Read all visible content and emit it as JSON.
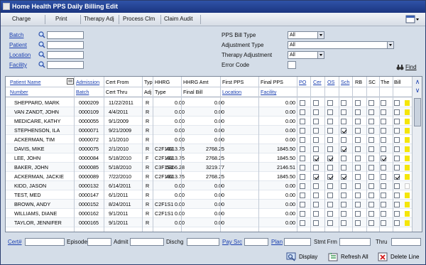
{
  "window": {
    "title": "Home Health PPS Daily Billing Edit"
  },
  "menu": {
    "items": [
      "Charge",
      "Print",
      "Therapy Adj",
      "Process Clm",
      "Claim Audit"
    ]
  },
  "filters": {
    "left": [
      {
        "label": "Batch",
        "value": ""
      },
      {
        "label": "Patient",
        "value": ""
      },
      {
        "label": "Location",
        "value": ""
      },
      {
        "label": "Facility",
        "value": ""
      }
    ],
    "right": [
      {
        "label": "PPS Bill Type",
        "value": "All"
      },
      {
        "label": "Adjustment Type",
        "value": "All"
      },
      {
        "label": "Therapy Adjustment",
        "value": "All"
      },
      {
        "label": "Error Code",
        "value": ""
      }
    ],
    "find_label": "Find"
  },
  "grid": {
    "headers_top": [
      "Patient Name",
      "Admission",
      "Cert From",
      "Typ",
      "HHRG",
      "HHRG Amt",
      "First PPS",
      "Final PPS",
      "PO",
      "Cer",
      "OS",
      "Sch",
      "RB",
      "SC",
      "The",
      "Bill"
    ],
    "headers_bottom": [
      "Number",
      "Batch",
      "Cert Thru",
      "Adj",
      "Type",
      "Final Bill",
      "Location",
      "Facility"
    ],
    "rows": [
      {
        "name": "SHEPPARD, MARK",
        "adm": "0000209",
        "cert": "11/22/2011",
        "typ": "R",
        "hhrg": "",
        "amt": "0.00",
        "first": "0.00",
        "final": "0.00",
        "checks": [
          0,
          0,
          0,
          0,
          0,
          0,
          0,
          0
        ],
        "flag": "#f4e60a"
      },
      {
        "name": "VAN ZANDT, JOHN",
        "adm": "0000109",
        "cert": "4/4/2011",
        "typ": "R",
        "hhrg": "",
        "amt": "0.00",
        "first": "0.00",
        "final": "0.00",
        "checks": [
          0,
          0,
          0,
          0,
          0,
          0,
          0,
          0
        ],
        "flag": "#f4e60a"
      },
      {
        "name": "MEDICARE, KATHY",
        "adm": "0000055",
        "cert": "9/1/2009",
        "typ": "R",
        "hhrg": "",
        "amt": "0.00",
        "first": "0.00",
        "final": "0.00",
        "checks": [
          0,
          0,
          0,
          0,
          0,
          0,
          0,
          0
        ],
        "flag": "#f4e60a"
      },
      {
        "name": "STEPHENSON, ILA",
        "adm": "0000071",
        "cert": "9/21/2009",
        "typ": "R",
        "hhrg": "",
        "amt": "0.00",
        "first": "0.00",
        "final": "0.00",
        "checks": [
          0,
          0,
          0,
          1,
          0,
          0,
          0,
          0
        ],
        "flag": "#f4e60a"
      },
      {
        "name": "ACKERMAN, TIM",
        "adm": "0000072",
        "cert": "1/1/2010",
        "typ": "R",
        "hhrg": "",
        "amt": "0.00",
        "first": "0.00",
        "final": "0.00",
        "checks": [
          0,
          0,
          0,
          0,
          0,
          0,
          0,
          0
        ],
        "flag": "#f4e60a"
      },
      {
        "name": "DAVIS, MIKE",
        "adm": "0000075",
        "cert": "2/1/2010",
        "typ": "R",
        "hhrg": "C2F1S1",
        "amt": "4613.75",
        "first": "2768.25",
        "final": "1845.50",
        "checks": [
          0,
          0,
          0,
          1,
          0,
          0,
          0,
          0
        ],
        "flag": "#f4e60a"
      },
      {
        "name": "LEE, JOHN",
        "adm": "0000084",
        "cert": "5/18/2010",
        "typ": "F",
        "hhrg": "C2F1S1",
        "amt": "4613.75",
        "first": "2768.25",
        "final": "1845.50",
        "checks": [
          0,
          1,
          1,
          0,
          0,
          0,
          1,
          0
        ],
        "flag": "#f4e60a"
      },
      {
        "name": "BAKER, JOHN",
        "adm": "0000085",
        "cert": "5/18/2010",
        "typ": "R",
        "hhrg": "C3F1S1",
        "amt": "5366.28",
        "first": "3219.77",
        "final": "2146.51",
        "checks": [
          0,
          0,
          0,
          0,
          0,
          0,
          0,
          0
        ],
        "flag": "#f4e60a"
      },
      {
        "name": "ACKERMAN, JACKIE",
        "adm": "0000089",
        "cert": "7/22/2010",
        "typ": "R",
        "hhrg": "C2F1S1",
        "amt": "4613.75",
        "first": "2768.25",
        "final": "1845.50",
        "checks": [
          0,
          1,
          1,
          1,
          0,
          0,
          0,
          1
        ],
        "flag": "#f4e60a"
      },
      {
        "name": "KIDD, JASON",
        "adm": "0000132",
        "cert": "6/14/2011",
        "typ": "R",
        "hhrg": "",
        "amt": "0.00",
        "first": "0.00",
        "final": "0.00",
        "checks": [
          0,
          0,
          0,
          0,
          0,
          0,
          0,
          0
        ],
        "flag": "#ffffff"
      },
      {
        "name": "TEST, MED",
        "adm": "0000147",
        "cert": "6/1/2011",
        "typ": "R",
        "hhrg": "",
        "amt": "0.00",
        "first": "0.00",
        "final": "0.00",
        "checks": [
          0,
          0,
          0,
          0,
          0,
          0,
          0,
          0
        ],
        "flag": "#f4e60a"
      },
      {
        "name": "BROWN, ANDY",
        "adm": "0000152",
        "cert": "8/24/2011",
        "typ": "R",
        "hhrg": "C2F1S1",
        "amt": "0.00",
        "first": "0.00",
        "final": "0.00",
        "checks": [
          0,
          0,
          0,
          0,
          0,
          0,
          0,
          0
        ],
        "flag": "#f4e60a"
      },
      {
        "name": "WILLIAMS, DIANE",
        "adm": "0000162",
        "cert": "9/1/2011",
        "typ": "R",
        "hhrg": "C2F1S1",
        "amt": "0.00",
        "first": "0.00",
        "final": "0.00",
        "checks": [
          0,
          0,
          0,
          0,
          0,
          0,
          0,
          0
        ],
        "flag": "#f4e60a"
      },
      {
        "name": "TAYLOR, JENNIFER",
        "adm": "0000165",
        "cert": "9/1/2011",
        "typ": "R",
        "hhrg": "",
        "amt": "0.00",
        "first": "0.00",
        "final": "0.00",
        "checks": [
          0,
          0,
          0,
          0,
          0,
          0,
          0,
          0
        ],
        "flag": "#f4e60a"
      }
    ]
  },
  "footer": {
    "fields": [
      {
        "label": "Cert#",
        "link": true
      },
      {
        "label": "Episode",
        "link": false
      },
      {
        "label": "Admit",
        "link": false
      },
      {
        "label": "Dischg",
        "link": false
      },
      {
        "label": "Pay Src",
        "link": true
      },
      {
        "label": "Plan",
        "link": true
      },
      {
        "label": "Stmt Frm",
        "link": false
      },
      {
        "label": "Thru",
        "link": false
      }
    ]
  },
  "actions": {
    "display": "Display",
    "refresh": "Refresh All",
    "delete": "Delete Line"
  },
  "colors": {
    "titlebar": "#1b3580",
    "link": "#1a3fb0",
    "flag_yellow": "#f4e60a",
    "app_bg": "#d4dde8"
  }
}
